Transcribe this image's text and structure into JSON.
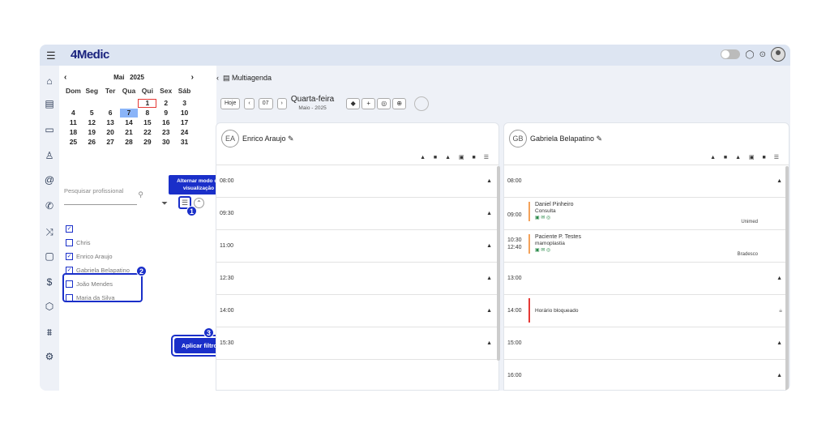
{
  "app": {
    "logo_prefix": "4",
    "logo_name": "Medic"
  },
  "calendar": {
    "month": "Mai",
    "year": "2025",
    "weekdays": [
      "Dom",
      "Seg",
      "Ter",
      "Qua",
      "Qui",
      "Sex",
      "Sáb"
    ],
    "weeks": [
      [
        "",
        "",
        "",
        "",
        "1",
        "2",
        "3"
      ],
      [
        "4",
        "5",
        "6",
        "7",
        "8",
        "9",
        "10"
      ],
      [
        "11",
        "12",
        "13",
        "14",
        "15",
        "16",
        "17"
      ],
      [
        "18",
        "19",
        "20",
        "21",
        "22",
        "23",
        "24"
      ],
      [
        "25",
        "26",
        "27",
        "28",
        "29",
        "30",
        "31"
      ]
    ],
    "today": "1",
    "selected": "7"
  },
  "sidebar_search": {
    "placeholder": "Pesquisar profissional"
  },
  "tooltip": "Alternar modo de visualização",
  "badges": [
    "1",
    "2",
    "3"
  ],
  "professionals": [
    {
      "name": "",
      "checked": true
    },
    {
      "name": "Chris",
      "checked": false
    },
    {
      "name": "Enrico Araujo",
      "checked": true
    },
    {
      "name": "Gabriela Belapatino",
      "checked": true
    },
    {
      "name": "João Mendes",
      "checked": false
    },
    {
      "name": "Maria da Silva",
      "checked": false
    }
  ],
  "apply_button": "Aplicar filtro",
  "main": {
    "title": "Multiagenda",
    "today_btn": "Hoje",
    "day_num": "07",
    "day_name": "Quarta-feira",
    "month_year": "Maio - 2025"
  },
  "columns": [
    {
      "initials": "EA",
      "name": "Enrico Araujo",
      "slots": [
        {
          "time": "08:00"
        },
        {
          "time": "09:30"
        },
        {
          "time": "11:00"
        },
        {
          "time": "12:30"
        },
        {
          "time": "14:00"
        },
        {
          "time": "15:30"
        }
      ]
    },
    {
      "initials": "GB",
      "name": "Gabriela Belapatino",
      "slots": [
        {
          "time": "08:00"
        },
        {
          "time": "09:00",
          "patient": "Daniel Pinheiro",
          "type": "Consulta",
          "insurance": "Unimed"
        },
        {
          "time": "10:30",
          "time_end": "12:40",
          "patient": "Paciente P. Testes",
          "type": "mamoplastia",
          "insurance": "Bradesco"
        },
        {
          "time": "13:00"
        },
        {
          "time": "14:00",
          "blocked": "Horário bloqueado"
        },
        {
          "time": "15:00"
        },
        {
          "time": "16:00"
        }
      ]
    }
  ],
  "colors": {
    "accent": "#1a2fc9",
    "topbar": "#dde5f2",
    "selected_day": "#8ab4f8",
    "today_border": "#e53935",
    "appt_bar": "#f4a25a",
    "blocked_bar": "#e53935"
  }
}
